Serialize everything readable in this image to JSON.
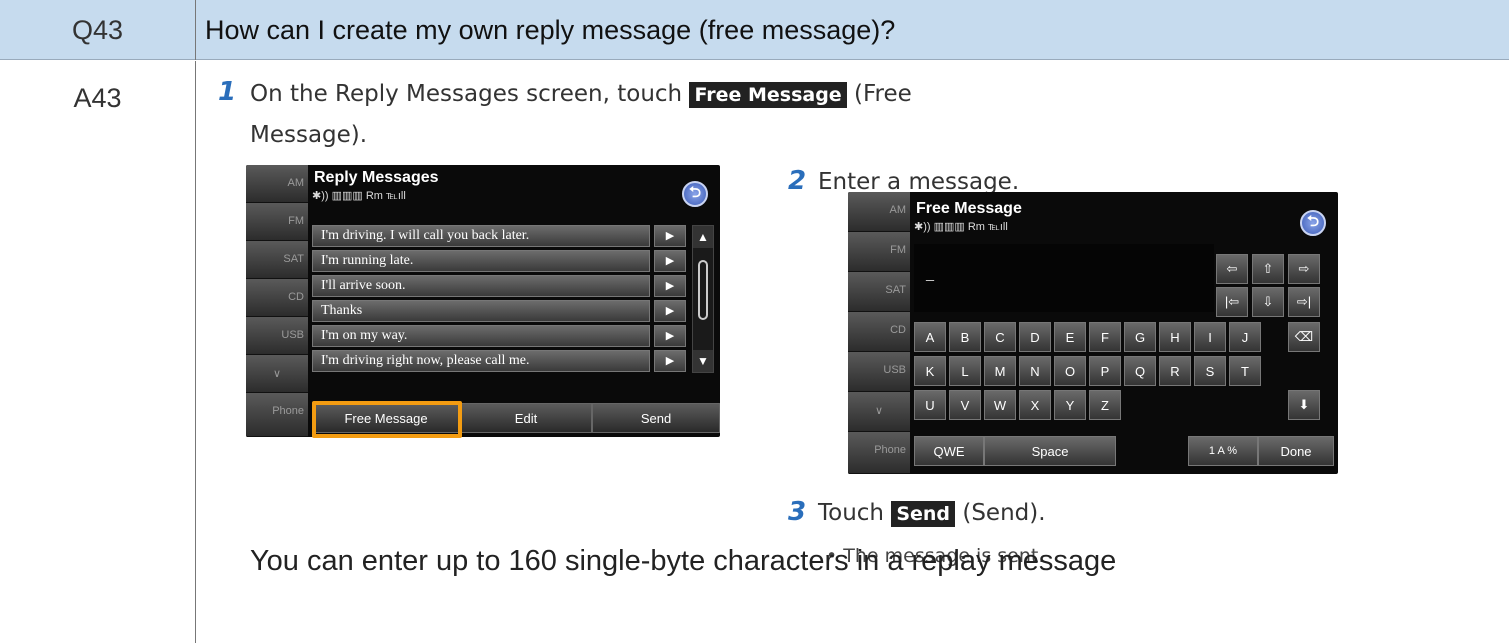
{
  "question": {
    "number": "Q43",
    "text": "How can I create my own reply message (free message)?"
  },
  "answer": {
    "number": "A43",
    "step1": {
      "num": "1",
      "text_before": "On the Reply Messages screen, touch",
      "chip": "Free Message",
      "text_after": "(Free",
      "text_line2": "Message)."
    },
    "step2": {
      "num": "2",
      "text": "Enter a message."
    },
    "step3": {
      "num": "3",
      "text_before": "Touch",
      "chip": "Send",
      "text_after": "(Send).",
      "bullet": "• The message is sent."
    },
    "note": "You can enter up to 160 single-byte characters in a replay message"
  },
  "screen1": {
    "title": "Reply Messages",
    "status": "✱)) ▥▥▥ Rm ℡ıll",
    "side_tabs": [
      "AM",
      "FM",
      "SAT",
      "CD",
      "USB",
      "∨",
      "Phone"
    ],
    "messages": [
      "I'm driving. I will call you back later.",
      "I'm running late.",
      "I'll arrive soon.",
      "Thanks",
      "I'm on my way.",
      "I'm driving right now, please call me."
    ],
    "play_glyph": "▶",
    "scroll_up": "▲",
    "scroll_down": "▼",
    "buttons": {
      "free_message": "Free Message",
      "edit": "Edit",
      "send": "Send"
    },
    "back_glyph": "⮌"
  },
  "screen2": {
    "title": "Free Message",
    "status": "✱)) ▥▥▥ Rm ℡ıll",
    "side_tabs": [
      "AM",
      "FM",
      "SAT",
      "CD",
      "USB",
      "∨",
      "Phone"
    ],
    "cursor": "_",
    "nav_keys": [
      "⇦",
      "⇧",
      "⇨",
      "|⇦",
      "⇩",
      "⇨|"
    ],
    "row1": [
      "A",
      "B",
      "C",
      "D",
      "E",
      "F",
      "G",
      "H",
      "I",
      "J"
    ],
    "row2": [
      "K",
      "L",
      "M",
      "N",
      "O",
      "P",
      "Q",
      "R",
      "S",
      "T"
    ],
    "row3": [
      "U",
      "V",
      "W",
      "X",
      "Y",
      "Z"
    ],
    "backspace": "⌫",
    "enter": "⬇",
    "bottom": {
      "qwe": "QWE",
      "space": "Space",
      "mode": "1 A %",
      "done": "Done"
    },
    "back_glyph": "⮌"
  },
  "colors": {
    "header_bg": "#c6dbee",
    "step_num": "#2a6ebb",
    "highlight": "#f39c12"
  }
}
